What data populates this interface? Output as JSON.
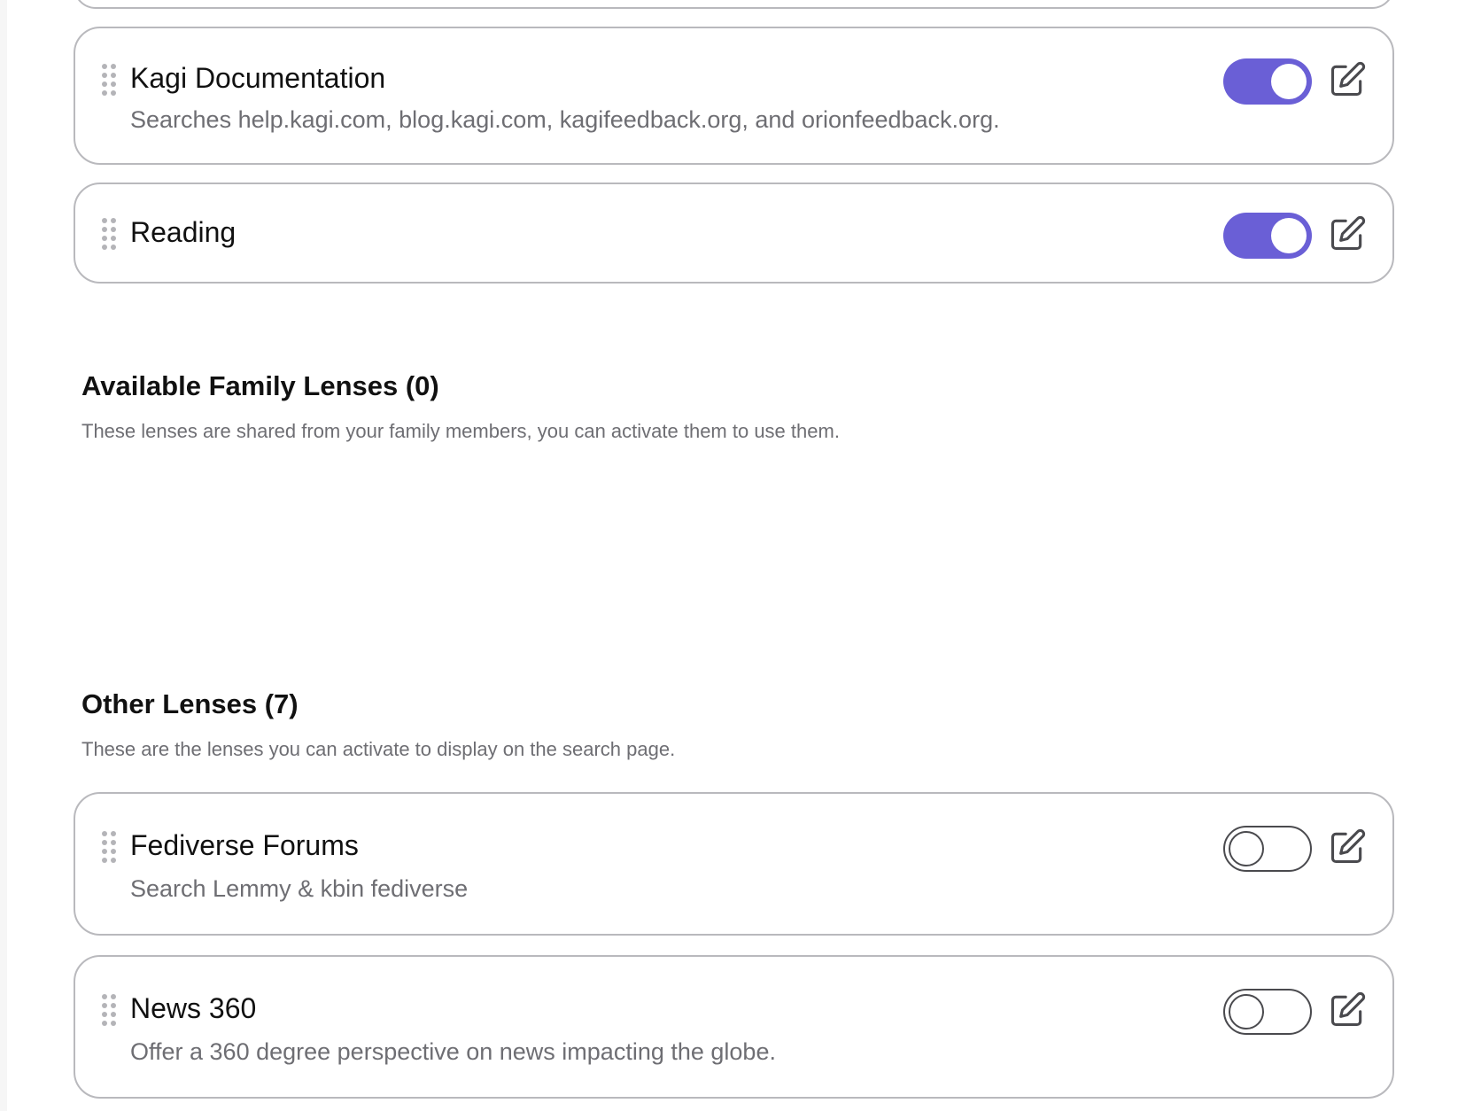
{
  "colors": {
    "accent": "#6a5fd6",
    "card_border": "#b9b9bd",
    "muted_text": "#6e6e73"
  },
  "active_lenses": [
    {
      "title": "Kagi Documentation",
      "description": "Searches help.kagi.com, blog.kagi.com, kagifeedback.org, and orionfeedback.org.",
      "enabled": true
    },
    {
      "title": "Reading",
      "description": "",
      "enabled": true
    }
  ],
  "family_section": {
    "title": "Available Family Lenses (0)",
    "description": "These lenses are shared from your family members, you can activate them to use them."
  },
  "other_section": {
    "title": "Other Lenses (7)",
    "description": "These are the lenses you can activate to display on the search page."
  },
  "other_lenses": [
    {
      "title": "Fediverse Forums",
      "description": "Search Lemmy & kbin fediverse",
      "enabled": false
    },
    {
      "title": "News 360",
      "description": "Offer a 360 degree perspective on news impacting the globe.",
      "enabled": false
    }
  ],
  "icons": {
    "drag": "drag-handle-icon",
    "edit": "pencil-square-icon"
  }
}
